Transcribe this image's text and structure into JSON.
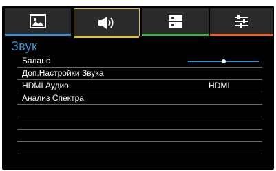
{
  "colors": {
    "accent": "#3e8fc9",
    "tab_picture_underline": "#3e8fc9",
    "tab_sound_underline": "#d9c63d",
    "tab_setup_underline": "#3fae49",
    "tab_options_underline": "#e2652d",
    "section_title": "#3e8fc9"
  },
  "tabs": [
    {
      "icon": "picture-icon"
    },
    {
      "icon": "speaker-icon"
    },
    {
      "icon": "setup-icon"
    },
    {
      "icon": "sliders-icon"
    }
  ],
  "section_title": "Звук",
  "menu": {
    "items": [
      {
        "label": "Баланс",
        "value": "",
        "slider_fraction": 0.5
      },
      {
        "label": "Доп.Настройки Звука",
        "value": ""
      },
      {
        "label": "HDMI Аудио",
        "value": "HDMI"
      },
      {
        "label": "Анализ Спектра",
        "value": ""
      },
      {
        "label": "",
        "value": ""
      },
      {
        "label": "",
        "value": ""
      },
      {
        "label": "",
        "value": ""
      },
      {
        "label": "",
        "value": ""
      }
    ]
  }
}
